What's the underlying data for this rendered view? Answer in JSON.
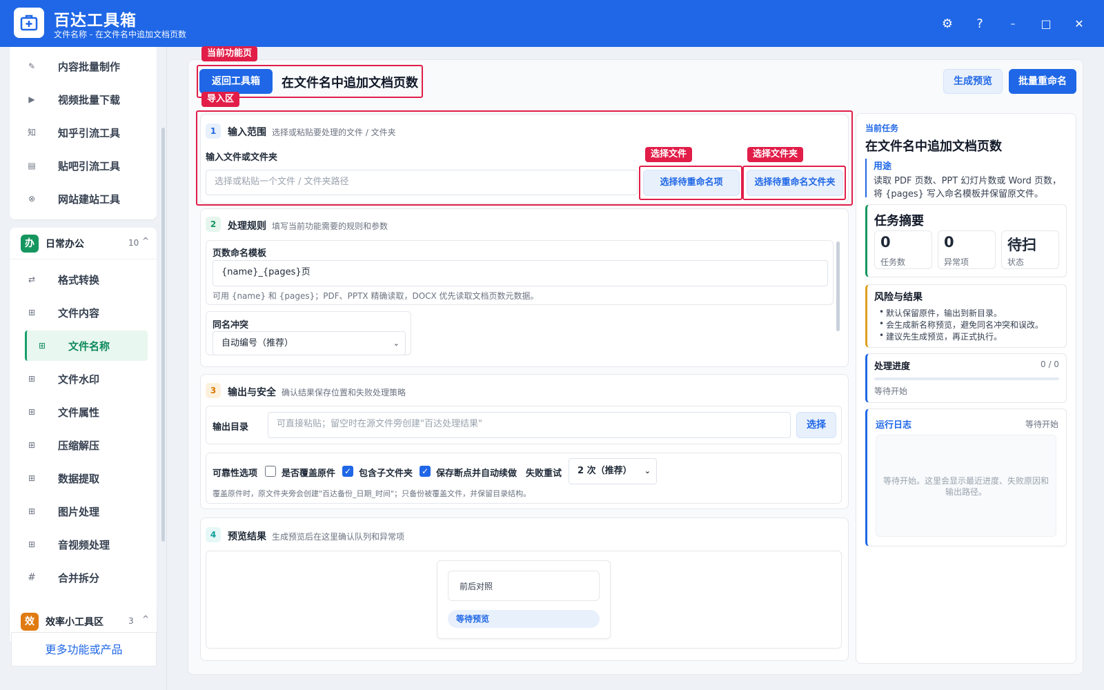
{
  "window": {
    "title": "百达工具箱",
    "subtitle": "文件名称 - 在文件名中追加文档页数",
    "controls": {
      "settings": "⚙",
      "help": "?",
      "minimize": "–",
      "maximize": "□",
      "close": "✕"
    }
  },
  "sidebar": {
    "top_items": [
      {
        "label": "内容批量制作",
        "icon": "✎"
      },
      {
        "label": "视频批量下载",
        "icon": "▶"
      },
      {
        "label": "知乎引流工具",
        "icon": "知"
      },
      {
        "label": "贴吧引流工具",
        "icon": "▤"
      },
      {
        "label": "网站建站工具",
        "icon": "⊗"
      }
    ],
    "group_office": {
      "badge": "办",
      "title": "日常办公",
      "count": "10",
      "chevron": "^",
      "color": "#16965f"
    },
    "office_items": [
      {
        "label": "格式转换",
        "icon": "⇄"
      },
      {
        "label": "文件内容",
        "icon": "⊞"
      },
      {
        "label": "文件名称",
        "icon": "⊞"
      },
      {
        "label": "文件水印",
        "icon": "⊞"
      },
      {
        "label": "文件属性",
        "icon": "⊞"
      },
      {
        "label": "压缩解压",
        "icon": "⊞"
      },
      {
        "label": "数据提取",
        "icon": "⊞"
      },
      {
        "label": "图片处理",
        "icon": "⊞"
      },
      {
        "label": "音视频处理",
        "icon": "⊞"
      },
      {
        "label": "合并拆分",
        "icon": "#"
      }
    ],
    "group_efficiency": {
      "badge": "效",
      "title": "效率小工具区",
      "count": "3",
      "chevron": "^",
      "color": "#e07b12"
    },
    "more_button": "更多功能或产品"
  },
  "annotations": {
    "current_page": "当前功能页",
    "import_area": "导入区",
    "select_file": "选择文件",
    "select_folder": "选择文件夹"
  },
  "header": {
    "back_button": "返回工具箱",
    "page_title": "在文件名中追加文档页数",
    "preview_button": "生成预览",
    "rename_button": "批量重命名"
  },
  "step1": {
    "num": "1",
    "title": "输入范围",
    "desc": "选择或粘贴要处理的文件 / 文件夹",
    "field_label": "输入文件或文件夹",
    "placeholder": "选择或粘贴一个文件 / 文件夹路径",
    "select_file_button": "选择待重命名项",
    "select_folder_button": "选择待重命名文件夹"
  },
  "step2": {
    "num": "2",
    "title": "处理规则",
    "desc": "填写当前功能需要的规则和参数",
    "template_label": "页数命名模板",
    "template_value": "{name}_{pages}页",
    "template_hint": "可用 {name} 和 {pages}；PDF、PPTX 精确读取，DOCX 优先读取文档页数元数据。",
    "conflict_label": "同名冲突",
    "conflict_value": "自动编号（推荐）"
  },
  "step3": {
    "num": "3",
    "title": "输出与安全",
    "desc": "确认结果保存位置和失败处理策略",
    "output_label": "输出目录",
    "output_placeholder": "可直接粘贴；留空时在源文件旁创建\"百达处理结果\"",
    "choose_button": "选择",
    "reliability_label": "可靠性选项",
    "overwrite_label": "是否覆盖原件",
    "subfolder_label": "包含子文件夹",
    "resume_label": "保存断点并自动续做",
    "retry_label": "失败重试",
    "retry_value": "2 次（推荐）",
    "backup_hint": "覆盖原件时，原文件夹旁会创建\"百达备份_日期_时间\"；只备份被覆盖文件，并保留目录结构。"
  },
  "step4": {
    "num": "4",
    "title": "预览结果",
    "desc": "生成预览后在这里确认队列和异常项",
    "compare_label": "前后对照",
    "waiting_label": "等待预览"
  },
  "right_panel": {
    "current_task_label": "当前任务",
    "task_title": "在文件名中追加文档页数",
    "purpose_label": "用途",
    "purpose_text_1": "读取 PDF 页数、PPT 幻灯片数或 Word 页数，",
    "purpose_text_2": "将 {pages} 写入命名模板并保留原文件。",
    "summary_title": "任务摘要",
    "stats": [
      {
        "value": "0",
        "label": "任务数"
      },
      {
        "value": "0",
        "label": "异常项"
      },
      {
        "value": "待扫",
        "label": "状态"
      }
    ],
    "risk_title": "风险与结果",
    "risk_items": [
      "默认保留原件，输出到新目录。",
      "会生成新名称预览，避免同名冲突和误改。",
      "建议先生成预览，再正式执行。"
    ],
    "progress_title": "处理进度",
    "progress_count": "0 / 0",
    "progress_fraction": 0,
    "progress_status": "等待开始",
    "log_title": "运行日志",
    "log_status": "等待开始",
    "log_text_1": "等待开始。这里会显示最近进度、失败原因和",
    "log_text_2": "输出路径。"
  },
  "colors": {
    "accent": "#1f67e6",
    "annotation": "#e11d48",
    "success": "#16965f",
    "warning": "#e0a020"
  }
}
